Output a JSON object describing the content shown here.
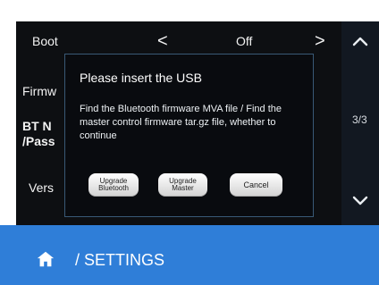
{
  "settings": {
    "rows": {
      "boot_label": "Boot",
      "boot_value": "Off",
      "firmware_label": "Firmw",
      "bt_name_label": "BT N",
      "password_label": "/Pass",
      "version_label": "Vers"
    },
    "navigation": {
      "left_arrow": "<",
      "right_arrow": ">",
      "page_indicator": "3/3",
      "up_icon": "chevron-up-icon",
      "down_icon": "chevron-down-icon"
    }
  },
  "dialog": {
    "title": "Please insert the USB",
    "message": "Find the Bluetooth firmware MVA file / Find the master control firmware tar.gz file, whether to continue",
    "buttons": {
      "upgrade_bluetooth": "Upgrade\nBluetooth",
      "upgrade_master": "Upgrade\nMaster",
      "cancel": "Cancel"
    }
  },
  "footer": {
    "home_icon": "home-icon",
    "breadcrumb": "/ SETTINGS"
  },
  "colors": {
    "panel_background": "#0d0f12",
    "sidebar_background": "#121821",
    "dialog_border": "#395976",
    "footer_background": "#2f7ed8",
    "text_primary": "#ffffff"
  }
}
